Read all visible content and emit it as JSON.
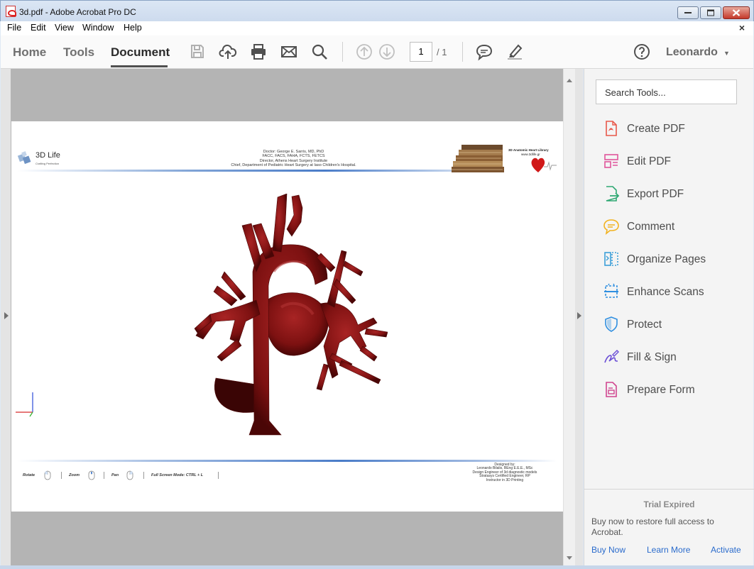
{
  "window": {
    "title": "3d.pdf - Adobe Acrobat Pro DC"
  },
  "menu": {
    "items": [
      "File",
      "Edit",
      "View",
      "Window",
      "Help"
    ],
    "close": "×"
  },
  "toolbar": {
    "tabs": [
      {
        "label": "Home"
      },
      {
        "label": "Tools"
      },
      {
        "label": "Document"
      }
    ],
    "active_tab": "Document",
    "current_page": "1",
    "page_total": "/ 1",
    "user": "Leonardo",
    "icons": [
      "save-icon",
      "upload-icon",
      "print-icon",
      "email-icon",
      "search-icon",
      "page-up-icon",
      "page-down-icon",
      "comment-icon",
      "highlight-icon",
      "help-icon"
    ]
  },
  "document": {
    "logo_name": "3D Life",
    "logo_tagline": "Crafting Perfection",
    "header_lines": [
      "Doctor: George E. Sarris, MD, PhD",
      "FACC, FACS, FAHA, FCTS, FETCS",
      "Director, Athens Heart Surgery Institute",
      "Chief, Department of Pediatric Heart Surgery at Iaso Children's Hospital."
    ],
    "library_title": "3D Anatomic Heart Library",
    "library_url": "www.3dlife.gr",
    "controls": [
      {
        "label": "Rotate"
      },
      {
        "label": "Zoom"
      },
      {
        "label": "Pan"
      },
      {
        "label": "Full Screen Mode:   CTRL + L"
      }
    ],
    "designed_by": [
      "Designed by:",
      "Leonardo Bilalis, BEng E.E.E., MSc",
      "Design Engineer of 3d diagnostic models",
      "Stratasys Certified Engineer, RP",
      "Instructor in 3D Printing"
    ]
  },
  "tools_pane": {
    "search_placeholder": "Search Tools...",
    "items": [
      {
        "label": "Create PDF",
        "icon": "create-pdf-icon",
        "color": "#e8584a"
      },
      {
        "label": "Edit PDF",
        "icon": "edit-pdf-icon",
        "color": "#e0559b"
      },
      {
        "label": "Export PDF",
        "icon": "export-pdf-icon",
        "color": "#2fa873"
      },
      {
        "label": "Comment",
        "icon": "comment-tool-icon",
        "color": "#f2b21f"
      },
      {
        "label": "Organize Pages",
        "icon": "organize-pages-icon",
        "color": "#3c9fd8"
      },
      {
        "label": "Enhance Scans",
        "icon": "enhance-scans-icon",
        "color": "#2f8fe0"
      },
      {
        "label": "Protect",
        "icon": "protect-icon",
        "color": "#2f8fe0"
      },
      {
        "label": "Fill & Sign",
        "icon": "fill-sign-icon",
        "color": "#6b4fd6"
      },
      {
        "label": "Prepare Form",
        "icon": "prepare-form-icon",
        "color": "#d0458f"
      }
    ],
    "trial_title": "Trial Expired",
    "trial_message": "Buy now to restore full access to Acrobat.",
    "links": [
      "Buy Now",
      "Learn More",
      "Activate"
    ]
  }
}
